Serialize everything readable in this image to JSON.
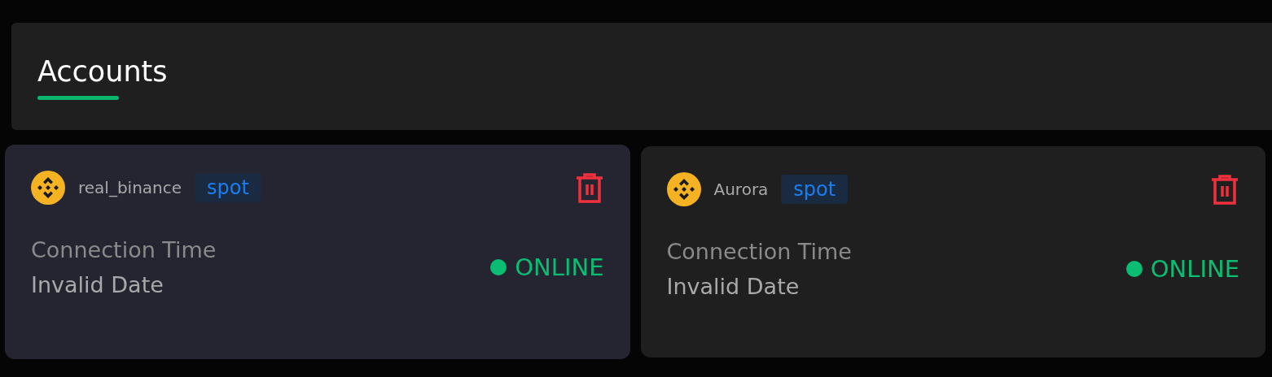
{
  "tabs": [
    {
      "label": "Accounts",
      "selected": true
    }
  ],
  "accounts": [
    {
      "name": "real_binance",
      "type": "spot",
      "selected": true,
      "time_label": "Connection Time",
      "time_value": "Invalid Date",
      "status": "ONLINE",
      "online": true
    },
    {
      "name": "Aurora",
      "type": "spot",
      "selected": false,
      "time_label": "Connection Time",
      "time_value": "Invalid Date",
      "status": "ONLINE",
      "online": true
    }
  ]
}
